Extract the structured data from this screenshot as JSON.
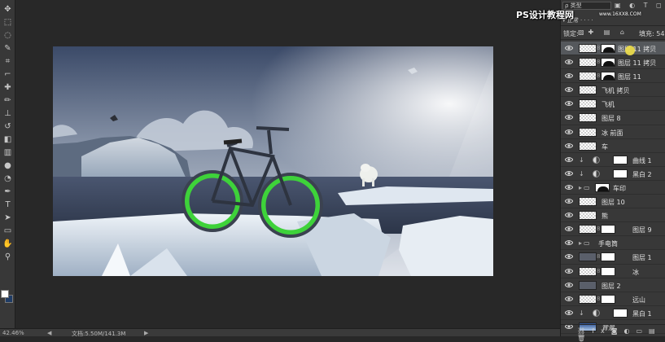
{
  "tools": [
    {
      "icon": "move-icon"
    },
    {
      "icon": "marquee-icon"
    },
    {
      "icon": "lasso-icon"
    },
    {
      "icon": "quick-select-icon"
    },
    {
      "icon": "crop-icon"
    },
    {
      "icon": "eyedropper-icon"
    },
    {
      "icon": "healing-brush-icon"
    },
    {
      "icon": "brush-icon"
    },
    {
      "icon": "clone-stamp-icon"
    },
    {
      "icon": "history-brush-icon"
    },
    {
      "icon": "eraser-icon"
    },
    {
      "icon": "gradient-icon"
    },
    {
      "icon": "blur-icon"
    },
    {
      "icon": "dodge-icon"
    },
    {
      "icon": "pen-icon"
    },
    {
      "icon": "type-icon"
    },
    {
      "icon": "path-select-icon"
    },
    {
      "icon": "shape-icon"
    },
    {
      "icon": "hand-icon"
    },
    {
      "icon": "zoom-icon"
    }
  ],
  "colors": {
    "foreground": "#ffffff",
    "background": "#1f3c66",
    "panel": "#383838",
    "selection": "#55585c",
    "bike_wheel": "#3ed23a"
  },
  "layers_panel": {
    "kind_filter": "ρ 类型",
    "lock_label": "锁定:",
    "fill_label": "填充: 54",
    "watermark": "PS设计教程网",
    "watermark_url": "www.16XX8.COM",
    "layers": [
      {
        "name": "图层 11 拷贝",
        "thumb": "checker",
        "mask": "dark",
        "selected": true
      },
      {
        "name": "图层 11 拷贝",
        "thumb": "checker",
        "mask": "dark",
        "selected": false
      },
      {
        "name": "图层 11",
        "thumb": "checker",
        "mask": "dark",
        "selected": false
      },
      {
        "name": "飞机 拷贝",
        "thumb": "checker",
        "mask": null,
        "selected": false
      },
      {
        "name": "飞机",
        "thumb": "checker",
        "mask": null,
        "selected": false
      },
      {
        "name": "图层 8",
        "thumb": "checker",
        "mask": null,
        "selected": false
      },
      {
        "name": "冰 前面",
        "thumb": "checker",
        "mask": null,
        "selected": false
      },
      {
        "name": "车",
        "thumb": "checker",
        "mask": null,
        "selected": false
      },
      {
        "name": "曲线 1",
        "thumb": "adjustment",
        "mask": "white",
        "selected": false
      },
      {
        "name": "黑白 2",
        "thumb": "adjustment",
        "mask": "white",
        "selected": false
      },
      {
        "name": "车印",
        "thumb": "folder",
        "mask": "dark",
        "selected": false
      },
      {
        "name": "图层 10",
        "thumb": "checker",
        "mask": null,
        "selected": false
      },
      {
        "name": "熊",
        "thumb": "checker",
        "mask": null,
        "selected": false
      },
      {
        "name": "图层 9",
        "thumb": "checker",
        "mask": "white",
        "selected": false
      },
      {
        "name": "手电筒",
        "thumb": "folder",
        "mask": null,
        "selected": false
      },
      {
        "name": "图层 1",
        "thumb": "dark",
        "mask": "white",
        "selected": false
      },
      {
        "name": "冰",
        "thumb": "checker",
        "mask": "white",
        "selected": false
      },
      {
        "name": "图层 2",
        "thumb": "dark",
        "mask": null,
        "selected": false
      },
      {
        "name": "远山",
        "thumb": "checker",
        "mask": "white",
        "selected": false
      },
      {
        "name": "黑白 1",
        "thumb": "adjustment",
        "mask": "white",
        "selected": false
      },
      {
        "name": "背景",
        "thumb": "sky",
        "mask": null,
        "selected": false
      }
    ]
  },
  "status": {
    "zoom": "42.46%",
    "doc_info": "文档:5.50M/141.3M"
  }
}
